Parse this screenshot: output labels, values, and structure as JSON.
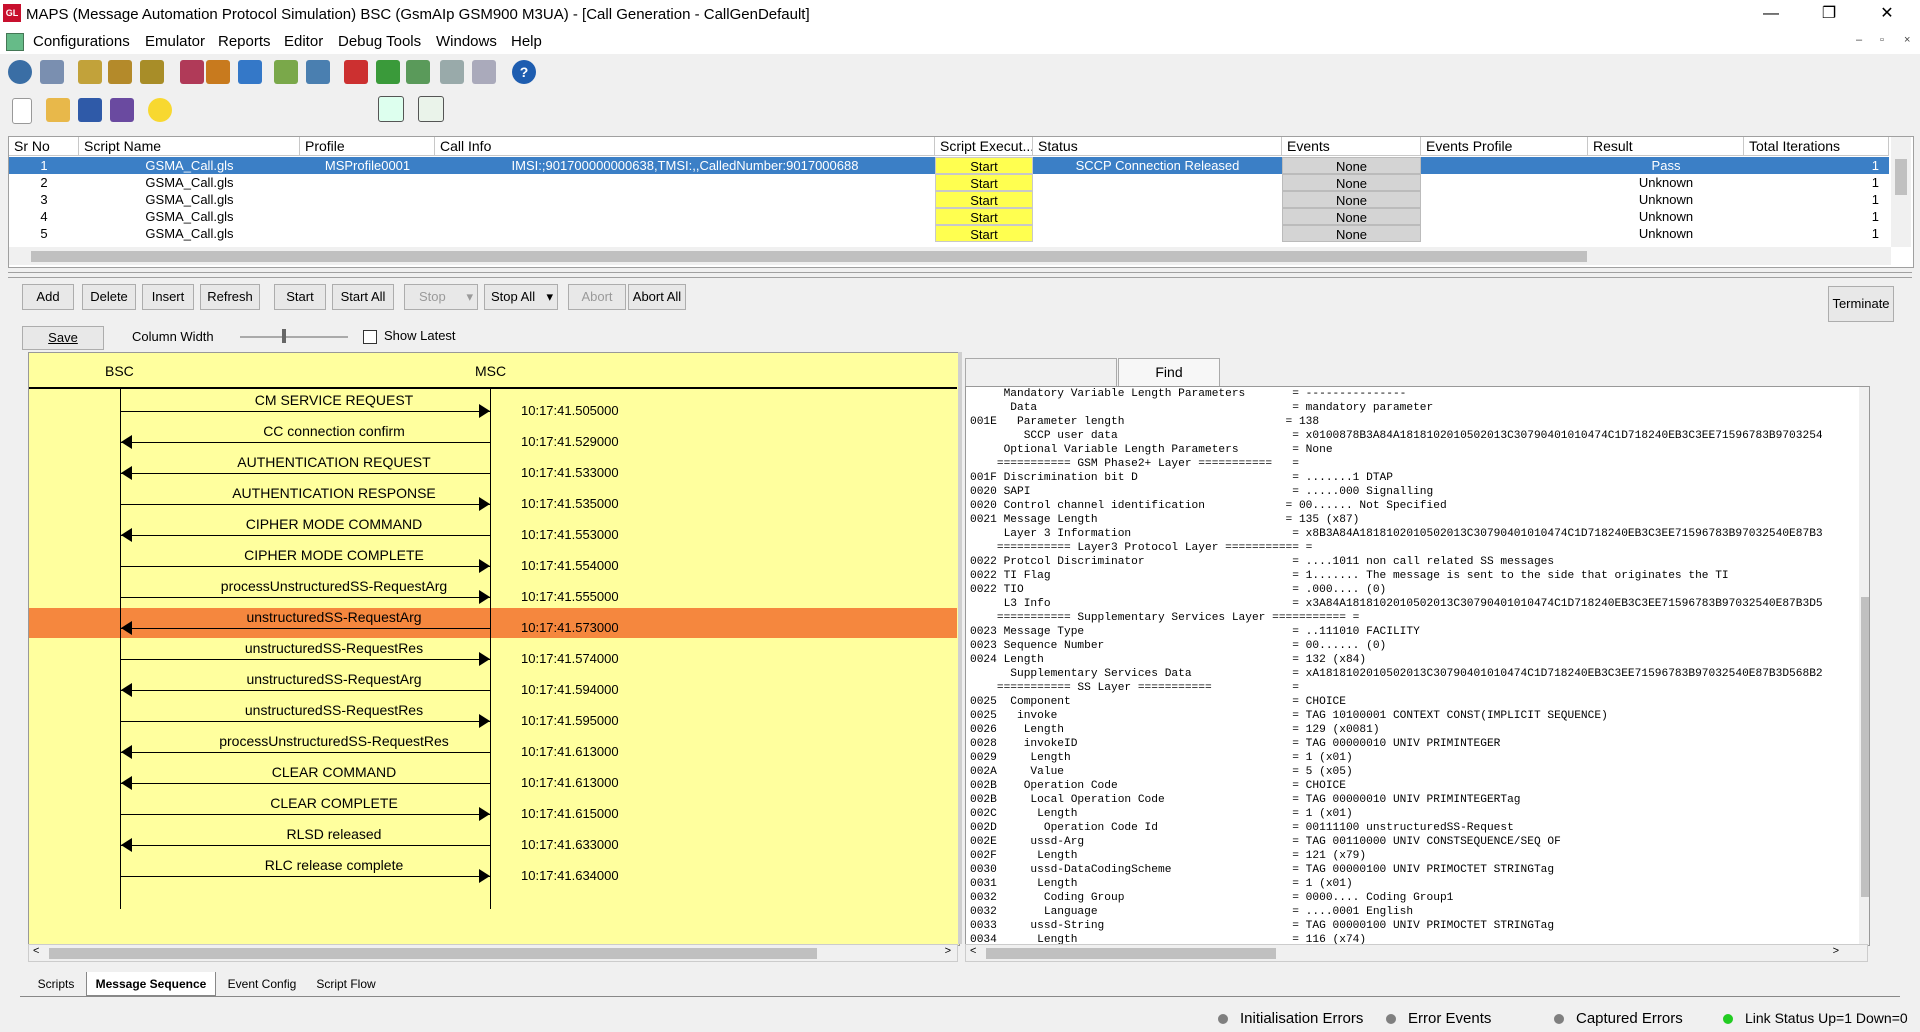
{
  "window": {
    "title": "MAPS (Message Automation Protocol Simulation) BSC (GsmAIp GSM900 M3UA) - [Call Generation - CallGenDefault]",
    "app_icon": "GL",
    "controls": {
      "minimize": "—",
      "restore": "❐",
      "close": "✕"
    }
  },
  "menubar": {
    "items": [
      "Configurations",
      "Emulator",
      "Reports",
      "Editor",
      "Debug Tools",
      "Windows",
      "Help"
    ],
    "mdi_controls": [
      "–",
      "▫",
      "×"
    ]
  },
  "grid": {
    "columns": [
      "Sr No",
      "Script Name",
      "Profile",
      "Call Info",
      "Script Execut...",
      "Status",
      "Events",
      "Events Profile",
      "Result",
      "Total Iterations"
    ],
    "rows": [
      {
        "sr": "1",
        "script": "GSMA_Call.gls",
        "profile": "MSProfile0001",
        "callinfo": "IMSI:;901700000000638,TMSI:,,CalledNumber:9017000688",
        "exec": "Start",
        "status": "SCCP Connection Released",
        "events": "None",
        "events_profile": "",
        "result": "Pass",
        "iterations": "1"
      },
      {
        "sr": "2",
        "script": "GSMA_Call.gls",
        "profile": "",
        "callinfo": "",
        "exec": "Start",
        "status": "",
        "events": "None",
        "events_profile": "",
        "result": "Unknown",
        "iterations": "1"
      },
      {
        "sr": "3",
        "script": "GSMA_Call.gls",
        "profile": "",
        "callinfo": "",
        "exec": "Start",
        "status": "",
        "events": "None",
        "events_profile": "",
        "result": "Unknown",
        "iterations": "1"
      },
      {
        "sr": "4",
        "script": "GSMA_Call.gls",
        "profile": "",
        "callinfo": "",
        "exec": "Start",
        "status": "",
        "events": "None",
        "events_profile": "",
        "result": "Unknown",
        "iterations": "1"
      },
      {
        "sr": "5",
        "script": "GSMA_Call.gls",
        "profile": "",
        "callinfo": "",
        "exec": "Start",
        "status": "",
        "events": "None",
        "events_profile": "",
        "result": "Unknown",
        "iterations": "1"
      }
    ]
  },
  "actions": {
    "add": "Add",
    "delete": "Delete",
    "insert": "Insert",
    "refresh": "Refresh",
    "start": "Start",
    "start_all": "Start All",
    "stop": "Stop",
    "stop_all": "Stop All",
    "abort": "Abort",
    "abort_all": "Abort All",
    "terminate": "Terminate"
  },
  "seq_toolbar": {
    "save": "Save",
    "column_width": "Column Width",
    "show_latest": "Show Latest"
  },
  "sequence": {
    "entities": [
      "BSC",
      "MSC"
    ],
    "messages": [
      {
        "label": "CM SERVICE REQUEST",
        "dir": "right",
        "time": "10:17:41.505000"
      },
      {
        "label": "CC connection confirm",
        "dir": "left",
        "time": "10:17:41.529000"
      },
      {
        "label": "AUTHENTICATION REQUEST",
        "dir": "left",
        "time": "10:17:41.533000"
      },
      {
        "label": "AUTHENTICATION RESPONSE",
        "dir": "right",
        "time": "10:17:41.535000"
      },
      {
        "label": "CIPHER MODE COMMAND",
        "dir": "left",
        "time": "10:17:41.553000"
      },
      {
        "label": "CIPHER MODE COMPLETE",
        "dir": "right",
        "time": "10:17:41.554000"
      },
      {
        "label": "processUnstructuredSS-RequestArg",
        "dir": "right",
        "time": "10:17:41.555000"
      },
      {
        "label": "unstructuredSS-RequestArg",
        "dir": "left",
        "time": "10:17:41.573000",
        "selected": true
      },
      {
        "label": "unstructuredSS-RequestRes",
        "dir": "right",
        "time": "10:17:41.574000"
      },
      {
        "label": "unstructuredSS-RequestArg",
        "dir": "left",
        "time": "10:17:41.594000"
      },
      {
        "label": "unstructuredSS-RequestRes",
        "dir": "right",
        "time": "10:17:41.595000"
      },
      {
        "label": "processUnstructuredSS-RequestRes",
        "dir": "left",
        "time": "10:17:41.613000"
      },
      {
        "label": "CLEAR COMMAND",
        "dir": "left",
        "time": "10:17:41.613000"
      },
      {
        "label": "CLEAR COMPLETE",
        "dir": "right",
        "time": "10:17:41.615000"
      },
      {
        "label": "RLSD released",
        "dir": "left",
        "time": "10:17:41.633000"
      },
      {
        "label": "RLC release complete",
        "dir": "right",
        "time": "10:17:41.634000"
      }
    ]
  },
  "detail": {
    "find_tab": "Find",
    "lines": [
      "     Mandatory Variable Length Parameters       = ---------------",
      "      Data                                      = mandatory parameter",
      "001E   Parameter length                        = 138",
      "        SCCP user data                          = x0100878B3A84A1818102010502013C30790401010474C1D718240EB3C3EE71596783B9703254",
      "     Optional Variable Length Parameters        = None",
      "    =========== GSM Phase2+ Layer ===========   =",
      "001F Discrimination bit D                       = .......1 DTAP",
      "0020 SAPI                                       = .....000 Signalling",
      "0020 Control channel identification            = 00...... Not Specified",
      "0021 Message Length                            = 135 (x87)",
      "     Layer 3 Information                        = x8B3A84A1818102010502013C30790401010474C1D718240EB3C3EE71596783B97032540E87B3",
      "    =========== Layer3 Protocol Layer =========== =",
      "0022 Protcol Discriminator                      = ....1011 non call related SS messages",
      "0022 TI Flag                                    = 1....... The message is sent to the side that originates the TI",
      "0022 TIO                                        = .000.... (0)",
      "     L3 Info                                    = x3A84A1818102010502013C30790401010474C1D718240EB3C3EE71596783B97032540E87B3D5",
      "    =========== Supplementary Services Layer =========== =",
      "0023 Message Type                               = ..111010 FACILITY",
      "0023 Sequence Number                            = 00...... (0)",
      "0024 Length                                     = 132 (x84)",
      "      Supplementary Services Data               = xA1818102010502013C30790401010474C1D718240EB3C3EE71596783B97032540E87B3D568B2",
      "    =========== SS Layer ===========            =",
      "0025  Component                                 = CHOICE",
      "0025   invoke                                   = TAG 10100001 CONTEXT CONST(IMPLICIT SEQUENCE)",
      "0026    Length                                  = 129 (x0081)",
      "0028    invokeID                                = TAG 00000010 UNIV PRIMINTEGER",
      "0029     Length                                 = 1 (x01)",
      "002A     Value                                  = 5 (x05)",
      "002B    Operation Code                          = CHOICE",
      "002B     Local Operation Code                   = TAG 00000010 UNIV PRIMINTEGERTag",
      "002C      Length                                = 1 (x01)",
      "002D       Operation Code Id                    = 00111100 unstructuredSS-Request",
      "002E     ussd-Arg                               = TAG 00110000 UNIV CONSTSEQUENCE/SEQ OF",
      "002F      Length                                = 121 (x79)",
      "0030     ussd-DataCodingScheme                  = TAG 00000100 UNIV PRIMOCTET STRINGTag",
      "0031      Length                                = 1 (x01)",
      "0032       Coding Group                         = 0000.... Coding Group1",
      "0032       Language                             = ....0001 English",
      "0033     ussd-String                            = TAG 00000100 UNIV PRIMOCTET STRINGTag",
      "0034      Length                                = 116 (x74)"
    ]
  },
  "bottom_tabs": [
    "Scripts",
    "Message Sequence",
    "Event Config",
    "Script Flow"
  ],
  "status": {
    "init_errors": "Initialisation Errors",
    "error_events": "Error Events",
    "captured_errors": "Captured Errors",
    "link_status": "Link Status Up=1 Down=0"
  },
  "colors": {
    "selection": "#3b7fc6",
    "highlight_row": "#f5873e",
    "sequence_bg": "#ffff9e",
    "start_cell": "#ffff50",
    "link_ok": "#22cc22",
    "status_gray": "#7f7f7f"
  }
}
